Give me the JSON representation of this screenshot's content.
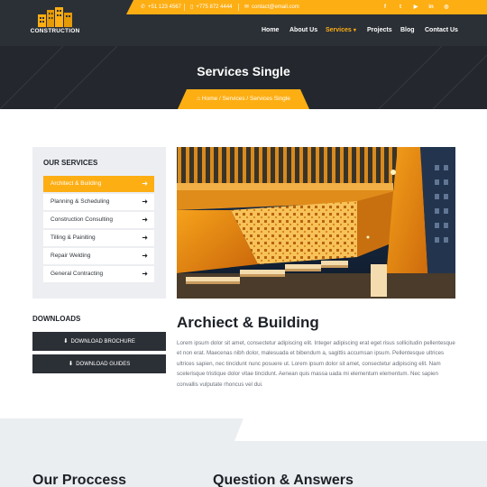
{
  "brand": {
    "name": "CONSTRUCTION",
    "logo_icon": "buildings-icon",
    "accent": "#fdae13",
    "dark": "#2b3036"
  },
  "topbar": {
    "phone": "+51 123 4567",
    "mobile": "+775 872 4444",
    "email": "contact@email.com",
    "social": [
      {
        "icon": "facebook-icon",
        "glyph": "f"
      },
      {
        "icon": "twitter-icon",
        "glyph": "t"
      },
      {
        "icon": "youtube-icon",
        "glyph": "▶"
      },
      {
        "icon": "linkedin-icon",
        "glyph": "in"
      },
      {
        "icon": "instagram-icon",
        "glyph": "◎"
      }
    ]
  },
  "nav": {
    "items": [
      "Home",
      "About Us",
      "Services",
      "Projects",
      "Blog",
      "Contact Us"
    ],
    "active": "Services"
  },
  "banner": {
    "title": "Services Single",
    "breadcrumb": {
      "home": "Home",
      "services": "Services",
      "current": "Services Single",
      "separator": "/"
    }
  },
  "sidebar": {
    "title": "OUR SERVICES",
    "items": [
      "Architect & Building",
      "Planning & Scheduling",
      "Construction Consulting",
      "Tilling & Painiting",
      "Repair Welding",
      "General Contracting"
    ],
    "active_index": 0,
    "downloads_title": "DOWNLOADS",
    "downloads": [
      "DOWNLOAD BROCHURE",
      "DOWNLOAD GUIDES"
    ]
  },
  "main": {
    "title": "Archiect & Building",
    "body": "Lorem ipsum dolor sit amet, consectetur adipiscing elit. Integer adipiscing erat eget risus sollicitudin pellentesque et non erat. Maecenas nibh dolor, malesuada et bibendum a, sagittis accumsan ipsum. Pellentesque ultrices ultrices sapien, nec tincidunt nunc posuere ut. Lorem ipsum dolor sit amet, consectetur adipiscing elit. Nam scelerisque tristique dolor vitae tincidunt. Aenean quis massa uada mi elementum elementum. Nec sapien convallis vulputate rhoncus vel dui."
  },
  "bottom": {
    "process_title": "Our Proccess",
    "qa_title": "Question & Answers"
  }
}
